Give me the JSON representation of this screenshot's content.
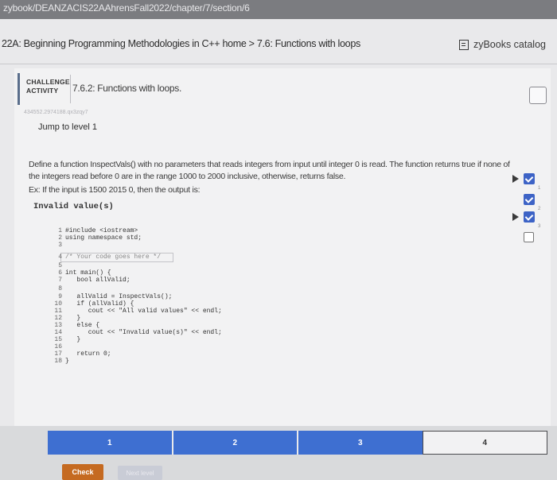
{
  "browser": {
    "url": "zybook/DEANZACIS22AAhrensFall2022/chapter/7/section/6"
  },
  "header": {
    "breadcrumb": "22A: Beginning Programming Methodologies in C++ home > 7.6: Functions with loops",
    "catalog_label": "zyBooks catalog"
  },
  "activity": {
    "badge_line1": "CHALLENGE",
    "badge_line2": "ACTIVITY",
    "title": "7.6.2: Functions with loops.",
    "id_text": "434552.2974188.qx3zqy7",
    "jump_label": "Jump to level 1",
    "description": "Define a function InspectVals() with no parameters that reads integers from input until integer 0 is read. The function returns true if none of the integers read before 0 are in the range 1000 to 2000 inclusive, otherwise, returns false.",
    "example": "Ex: If the input is 1500 2015 0, then the output is:",
    "expected_output": "Invalid value(s)"
  },
  "code": [
    {
      "n": "1",
      "text": "#include <iostream>"
    },
    {
      "n": "2",
      "text": "using namespace std;"
    },
    {
      "n": "3",
      "text": ""
    },
    {
      "n": "4",
      "text": "/* Your code goes here */"
    },
    {
      "n": "5",
      "text": ""
    },
    {
      "n": "6",
      "text": "int main() {"
    },
    {
      "n": "7",
      "text": "   bool allValid;"
    },
    {
      "n": "8",
      "text": ""
    },
    {
      "n": "9",
      "text": "   allValid = InspectVals();"
    },
    {
      "n": "10",
      "text": "   if (allValid) {"
    },
    {
      "n": "11",
      "text": "      cout << \"All valid values\" << endl;"
    },
    {
      "n": "12",
      "text": "   }"
    },
    {
      "n": "13",
      "text": "   else {"
    },
    {
      "n": "14",
      "text": "      cout << \"Invalid value(s)\" << endl;"
    },
    {
      "n": "15",
      "text": "   }"
    },
    {
      "n": "16",
      "text": ""
    },
    {
      "n": "17",
      "text": "   return 0;"
    },
    {
      "n": "18",
      "text": "}"
    }
  ],
  "levels": [
    {
      "label": "1",
      "status": "done"
    },
    {
      "label": "2",
      "status": "done"
    },
    {
      "label": "3",
      "status": "done"
    },
    {
      "label": "4",
      "status": "todo"
    }
  ],
  "level_checks": [
    "1",
    "2",
    "3"
  ],
  "buttons": {
    "check": "Check",
    "next": "Next level"
  },
  "colors": {
    "accent": "#3e6fd1",
    "check_button": "#c56a21"
  }
}
